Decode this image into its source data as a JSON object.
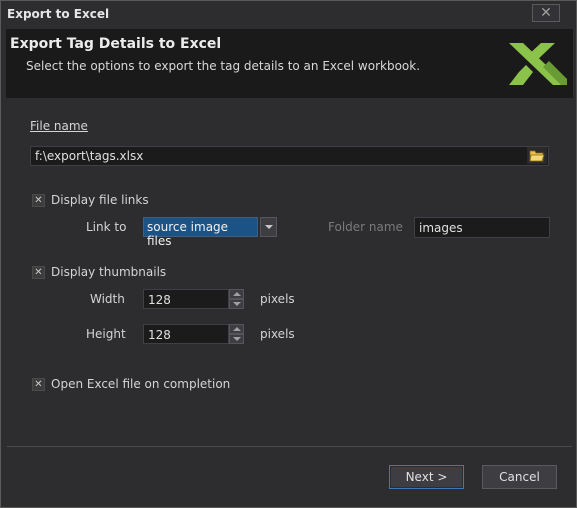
{
  "window": {
    "title": "Export to Excel",
    "close_glyph": "✕"
  },
  "header": {
    "title": "Export Tag Details to Excel",
    "subtitle": "Select the options to export the tag details to an Excel workbook.",
    "logo_icon": "excel-logo-icon",
    "logo_color": "#8bc34a"
  },
  "file": {
    "label": "File name",
    "value": "f:\\export\\tags.xlsx",
    "browse_icon": "folder-open-icon"
  },
  "file_links": {
    "checkbox_label": "Display file links",
    "checked": true,
    "link_to_label": "Link to",
    "link_to_value": "source image files",
    "folder_label": "Folder name",
    "folder_value": "images"
  },
  "thumbnails": {
    "checkbox_label": "Display thumbnails",
    "checked": true,
    "width_label": "Width",
    "width_value": "128",
    "width_unit": "pixels",
    "height_label": "Height",
    "height_value": "128",
    "height_unit": "pixels"
  },
  "open_excel": {
    "checkbox_label": "Open Excel file on completion",
    "checked": true
  },
  "buttons": {
    "next": "Next >",
    "cancel": "Cancel"
  },
  "colors": {
    "background": "#2d2d30",
    "header_bg": "#1a1a1a",
    "selection": "#1c5386",
    "accent_border": "#3d7ab8"
  }
}
